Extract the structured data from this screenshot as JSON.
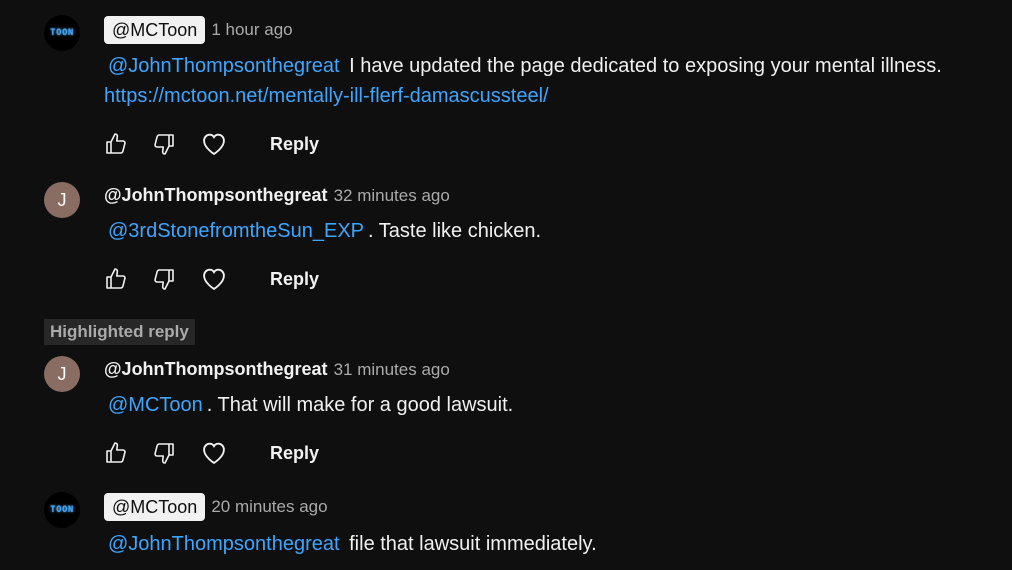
{
  "comments": [
    {
      "author": "@MCToon",
      "time": "1 hour ago",
      "avatar_text": "TOON",
      "mention": "@JohnThompsonthegreat",
      "text": "I have updated the page dedicated to exposing your mental illness.",
      "link": "https://mctoon.net/mentally-ill-flerf-damascussteel/",
      "reply_label": "Reply"
    },
    {
      "author": "@JohnThompsonthegreat",
      "time": "32 minutes ago",
      "avatar_text": "J",
      "mention": "@3rdStonefromtheSun_EXP",
      "text": ".  Taste like chicken.",
      "reply_label": "Reply"
    },
    {
      "author": "@JohnThompsonthegreat",
      "time": "31 minutes ago",
      "avatar_text": "J",
      "mention": "@MCToon",
      "text": ".  That will make for a good lawsuit.",
      "reply_label": "Reply"
    },
    {
      "author": "@MCToon",
      "time": "20 minutes ago",
      "avatar_text": "TOON",
      "mention": "@JohnThompsonthegreat",
      "text": "file that lawsuit immediately."
    }
  ],
  "highlighted_label": "Highlighted reply",
  "colors": {
    "background": "#0f0f0f",
    "mention": "#3ea6ff",
    "letter_avatar": "#8a6d62"
  },
  "icons": [
    "like-icon",
    "dislike-icon",
    "heart-icon"
  ]
}
